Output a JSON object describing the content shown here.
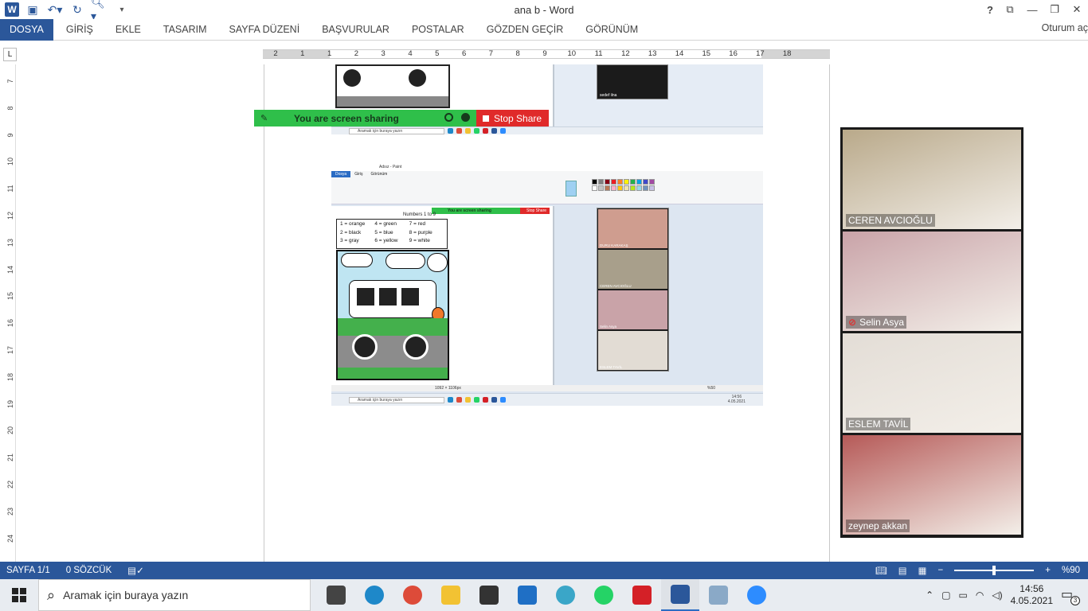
{
  "window": {
    "title": "ana b - Word"
  },
  "ribbon": {
    "file_tab": "DOSYA",
    "tabs": [
      "GİRİŞ",
      "EKLE",
      "TASARIM",
      "SAYFA DÜZENİ",
      "BAŞVURULAR",
      "POSTALAR",
      "GÖZDEN GEÇİR",
      "GÖRÜNÜM"
    ],
    "signin": "Oturum aç"
  },
  "ruler": {
    "corner": "L",
    "ticks": [
      "2",
      "1",
      "1",
      "2",
      "3",
      "4",
      "5",
      "6",
      "7",
      "8",
      "9",
      "10",
      "11",
      "12",
      "13",
      "14",
      "15",
      "16",
      "17",
      "18"
    ],
    "vticks": [
      "7",
      "8",
      "9",
      "10",
      "11",
      "12",
      "13",
      "14",
      "15",
      "16",
      "17",
      "18",
      "19",
      "20",
      "21",
      "22",
      "23",
      "24"
    ]
  },
  "sharing": {
    "banner_text": "You are screen sharing",
    "stop_label": "Stop Share"
  },
  "embedded": {
    "top_taskbar_search": "Aramak için buraya yazın",
    "top_zoom_name": "sedef ilna",
    "paint_title": "Adsız - Paint",
    "paint_tabs": [
      "Dosya",
      "Giriş",
      "Görünüm"
    ],
    "worksheet_heading": "Numbers 1 to 9",
    "legend": [
      "1 = orange",
      "4 = green",
      "7 = red",
      "2 = black",
      "5 = blue",
      "8 = purple",
      "3 = gray",
      "6 = yellow",
      "9 = white"
    ],
    "mini_banner": "You are screen sharing",
    "mini_stop": "Stop Share",
    "mini_names": [
      "DURU KARAKAŞ",
      "CEREN AVCIOĞLU",
      "Selin Asya",
      "ESLEM TAVİL"
    ],
    "size_text": "1092 × 1106px",
    "zoom_pct": "%50",
    "bottom_taskbar_search": "Aramak için buraya yazın",
    "bottom_clock_time": "14:56",
    "bottom_clock_date": "4.05.2021",
    "palette": [
      "#000000",
      "#7f7f7f",
      "#880015",
      "#ed1c24",
      "#ff7f27",
      "#fff200",
      "#22b14c",
      "#00a2e8",
      "#3f48cc",
      "#a349a4",
      "#ffffff",
      "#c3c3c3",
      "#b97a57",
      "#ffaec9",
      "#ffc90e",
      "#efe4b0",
      "#b5e61d",
      "#99d9ea",
      "#7092be",
      "#c8bfe7"
    ]
  },
  "participants": [
    {
      "name": "CEREN AVCIOĞLU",
      "muted": false,
      "bg": "#b9a98a"
    },
    {
      "name": "Selin Asya",
      "muted": true,
      "bg": "#c9a3a8"
    },
    {
      "name": "ESLEM TAVİL",
      "muted": false,
      "bg": "#e3ddd6"
    },
    {
      "name": "zeynep akkan",
      "muted": false,
      "bg": "#b65a58"
    }
  ],
  "status": {
    "page": "SAYFA 1/1",
    "words": "0 SÖZCÜK",
    "zoom": "%90",
    "zoom_level": 0.5
  },
  "taskbar": {
    "search_placeholder": "Aramak için buraya yazın",
    "time": "14:56",
    "date": "4.05.2021",
    "notifications": "3",
    "apps": [
      {
        "name": "task-view-icon",
        "color": "#444444"
      },
      {
        "name": "edge-icon",
        "color": "#1e88c9"
      },
      {
        "name": "chrome-icon",
        "color": "#dd4b39"
      },
      {
        "name": "file-explorer-icon",
        "color": "#f2c233"
      },
      {
        "name": "store-icon",
        "color": "#333333"
      },
      {
        "name": "mail-icon",
        "color": "#1f6fc5"
      },
      {
        "name": "eba-icon",
        "color": "#3aa6c8"
      },
      {
        "name": "whatsapp-icon",
        "color": "#25d366"
      },
      {
        "name": "acrobat-icon",
        "color": "#d42027"
      },
      {
        "name": "word-icon",
        "color": "#2b579a"
      },
      {
        "name": "paint-icon",
        "color": "#8aa9c7"
      },
      {
        "name": "zoom-icon",
        "color": "#2d8cff"
      }
    ]
  }
}
